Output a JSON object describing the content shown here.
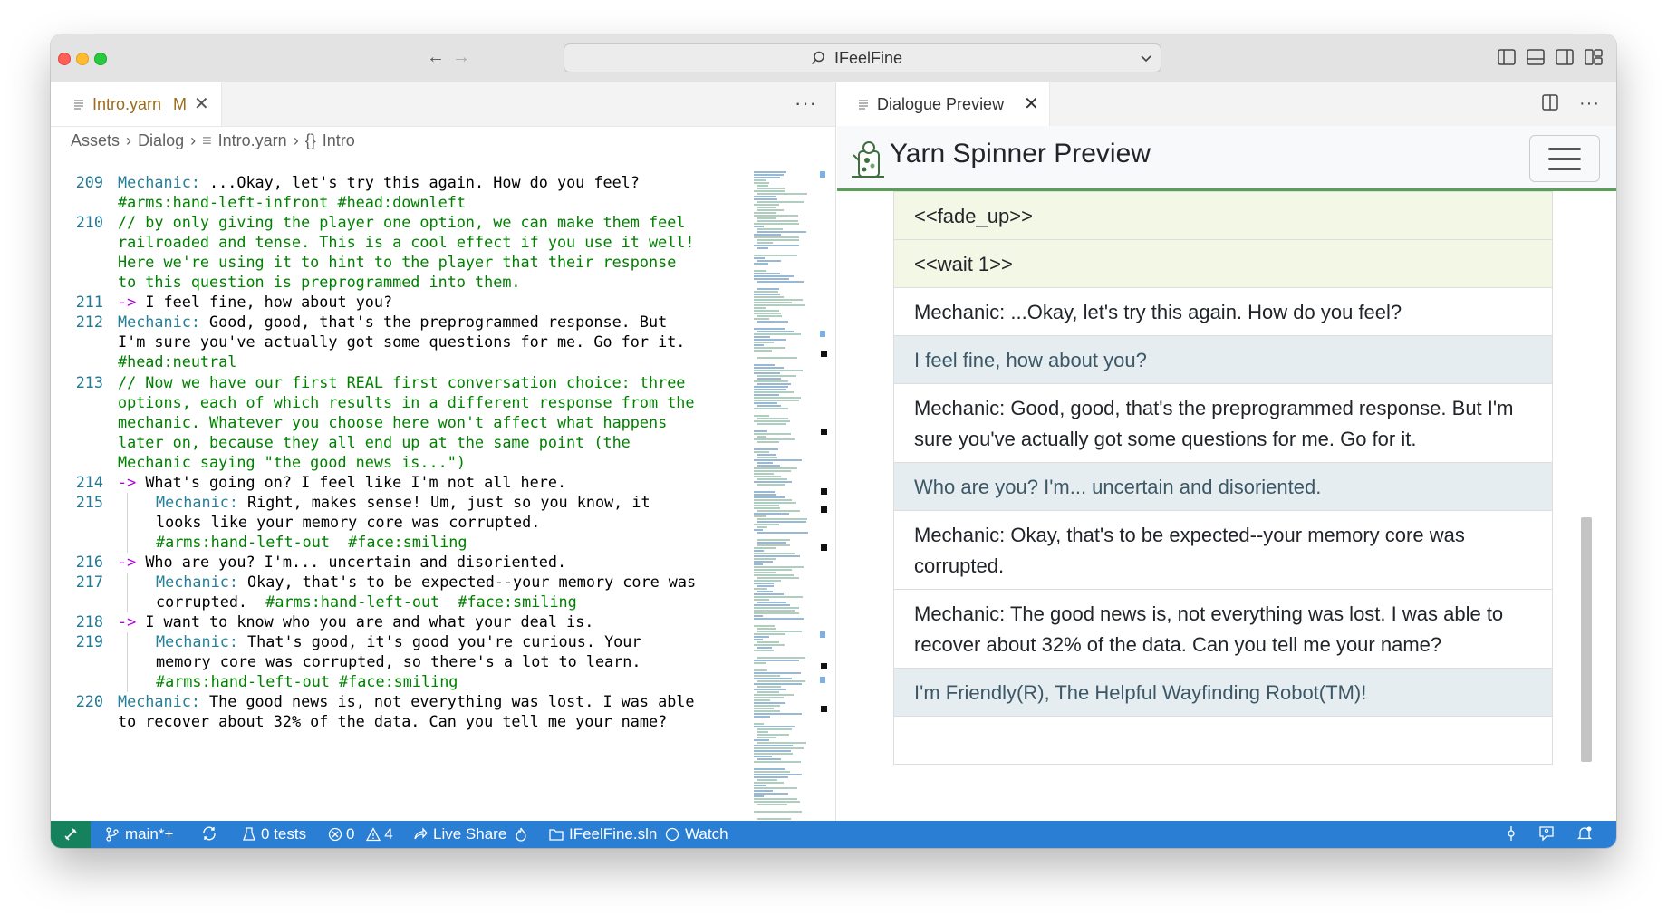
{
  "titlebar": {
    "title": "IFeelFine"
  },
  "editor": {
    "tab": {
      "filename": "Intro.yarn",
      "status": "M"
    },
    "more": "···",
    "breadcrumb": {
      "assets": "Assets",
      "dialog": "Dialog",
      "file": "Intro.yarn",
      "node_symbol": "{}",
      "node": "Intro"
    },
    "lines": [
      {
        "num": "209",
        "segments": [
          [
            "spk",
            "Mechanic:"
          ],
          [
            "txt",
            " ...Okay, let's try this again. How do you feel?"
          ]
        ]
      },
      {
        "num": "",
        "segments": [
          [
            "tag",
            "#arms:hand-left-infront #head:downleft"
          ]
        ]
      },
      {
        "num": "210",
        "segments": [
          [
            "cmt",
            "// by only giving the player one option, we can make them feel"
          ]
        ]
      },
      {
        "num": "",
        "segments": [
          [
            "cmt",
            "railroaded and tense. This is a cool effect if you use it well!"
          ]
        ]
      },
      {
        "num": "",
        "segments": [
          [
            "cmt",
            "Here we're using it to hint to the player that their response"
          ]
        ]
      },
      {
        "num": "",
        "segments": [
          [
            "cmt",
            "to this question is preprogrammed into them."
          ]
        ]
      },
      {
        "num": "211",
        "segments": [
          [
            "arr",
            "->"
          ],
          [
            "txt",
            " I feel fine, how about you?"
          ]
        ]
      },
      {
        "num": "212",
        "segments": [
          [
            "spk",
            "Mechanic:"
          ],
          [
            "txt",
            " Good, good, that's the preprogrammed response. But"
          ]
        ]
      },
      {
        "num": "",
        "segments": [
          [
            "txt",
            "I'm sure you've actually got some questions for me. Go for it."
          ]
        ]
      },
      {
        "num": "",
        "segments": [
          [
            "tag",
            "#head:neutral"
          ]
        ]
      },
      {
        "num": "213",
        "segments": [
          [
            "cmt",
            "// Now we have our first REAL first conversation choice: three"
          ]
        ]
      },
      {
        "num": "",
        "segments": [
          [
            "cmt",
            "options, each of which results in a different response from the"
          ]
        ]
      },
      {
        "num": "",
        "segments": [
          [
            "cmt",
            "mechanic. Whatever you choose here won't affect what happens"
          ]
        ]
      },
      {
        "num": "",
        "segments": [
          [
            "cmt",
            "later on, because they all end up at the same point (the"
          ]
        ]
      },
      {
        "num": "",
        "segments": [
          [
            "cmt",
            "Mechanic saying \"the good news is...\")"
          ]
        ]
      },
      {
        "num": "214",
        "segments": [
          [
            "arr",
            "->"
          ],
          [
            "txt",
            " What's going on? I feel like I'm not all here."
          ]
        ]
      },
      {
        "num": "215",
        "indent": true,
        "segments": [
          [
            "spk",
            "Mechanic:"
          ],
          [
            "txt",
            " Right, makes sense! Um, just so you know, it"
          ]
        ]
      },
      {
        "num": "",
        "indent": true,
        "segments": [
          [
            "txt",
            "looks like your memory core was corrupted."
          ]
        ]
      },
      {
        "num": "",
        "indent": true,
        "segments": [
          [
            "tag",
            "#arms:hand-left-out  #face:smiling"
          ]
        ]
      },
      {
        "num": "216",
        "segments": [
          [
            "arr",
            "->"
          ],
          [
            "txt",
            " Who are you? I'm... uncertain and disoriented."
          ]
        ]
      },
      {
        "num": "217",
        "indent": true,
        "segments": [
          [
            "spk",
            "Mechanic:"
          ],
          [
            "txt",
            " Okay, that's to be expected--your memory core was"
          ]
        ]
      },
      {
        "num": "",
        "indent": true,
        "segments": [
          [
            "txt",
            "corrupted.  "
          ],
          [
            "tag",
            "#arms:hand-left-out  #face:smiling"
          ]
        ]
      },
      {
        "num": "218",
        "segments": [
          [
            "arr",
            "->"
          ],
          [
            "txt",
            " I want to know who you are and what your deal is."
          ]
        ]
      },
      {
        "num": "219",
        "indent": true,
        "segments": [
          [
            "spk",
            "Mechanic:"
          ],
          [
            "txt",
            " That's good, it's good you're curious. Your"
          ]
        ]
      },
      {
        "num": "",
        "indent": true,
        "segments": [
          [
            "txt",
            "memory core was corrupted, so there's a lot to learn."
          ]
        ]
      },
      {
        "num": "",
        "indent": true,
        "segments": [
          [
            "tag",
            "#arms:hand-left-out #face:smiling"
          ]
        ]
      },
      {
        "num": "220",
        "segments": [
          [
            "spk",
            "Mechanic:"
          ],
          [
            "txt",
            " The good news is, not everything was lost. I was able"
          ]
        ]
      },
      {
        "num": "",
        "segments": [
          [
            "txt",
            "to recover about 32% of the data. Can you tell me your name?"
          ]
        ]
      }
    ]
  },
  "preview": {
    "tab": {
      "label": "Dialogue Preview"
    },
    "brand": "Yarn Spinner Preview",
    "items": [
      {
        "kind": "cmd",
        "text": "<<fade_up>>"
      },
      {
        "kind": "cmd",
        "text": "<<wait 1>>"
      },
      {
        "kind": "line",
        "text": "Mechanic: ...Okay, let's try this again. How do you feel?"
      },
      {
        "kind": "opt",
        "text": "I feel fine, how about you?"
      },
      {
        "kind": "line",
        "text": "Mechanic: Good, good, that's the preprogrammed response. But I'm sure you've actually got some questions for me. Go for it."
      },
      {
        "kind": "opt",
        "text": "Who are you? I'm... uncertain and disoriented."
      },
      {
        "kind": "line",
        "text": "Mechanic: Okay, that's to be expected--your memory core was corrupted."
      },
      {
        "kind": "line",
        "text": "Mechanic: The good news is, not everything was lost. I was able to recover about 32% of the data. Can you tell me your name?"
      },
      {
        "kind": "opt",
        "text": "I'm Friendly(R), The Helpful Wayfinding Robot(TM)!"
      },
      {
        "kind": "line",
        "text": ""
      }
    ]
  },
  "statusbar": {
    "branch": "main*+",
    "tests": "0 tests",
    "errors": "0",
    "warnings": "4",
    "live_share": "Live Share",
    "solution": "IFeelFine.sln",
    "watch": "Watch"
  },
  "colors": {
    "statusbar": "#2a7ed3",
    "remote": "#16825d",
    "comment": "#008000",
    "speaker": "#267f99",
    "arrow": "#af00db",
    "line_number": "#237893",
    "navbar_border": "#5a9e5a"
  }
}
